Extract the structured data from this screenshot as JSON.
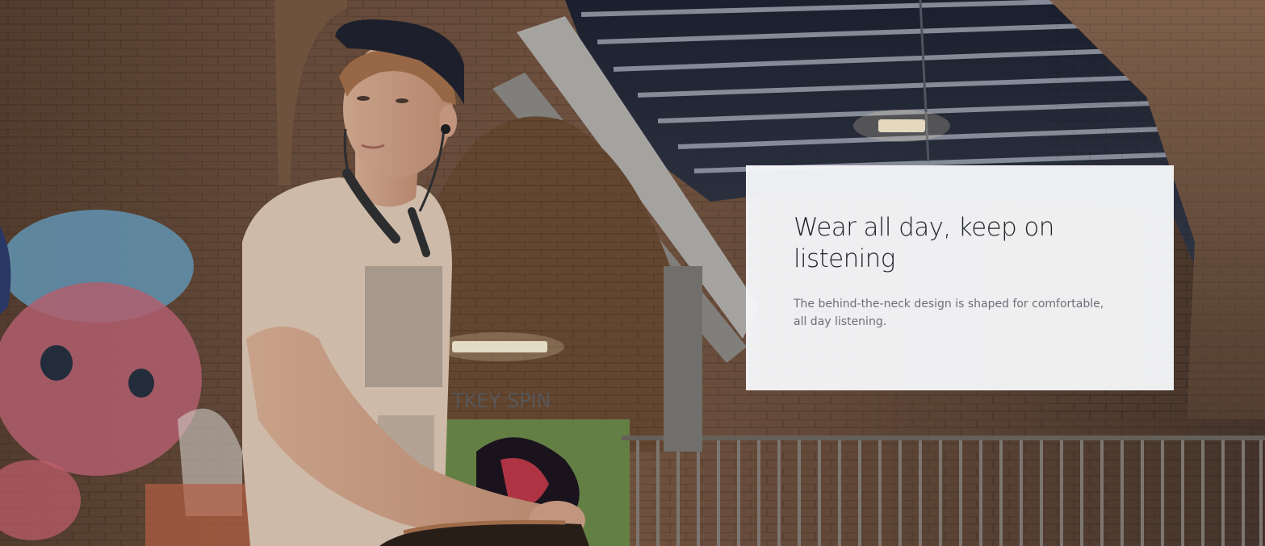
{
  "hero": {
    "image_description_icon": "person-wearing-neckband-headphones-photo",
    "card": {
      "title": "Wear all day, keep on listening",
      "text": "The behind-the-neck design is shaped for comfortable, all day listening."
    }
  },
  "colors": {
    "card_background": "#f5f6f8",
    "title": "#1f2328",
    "body_text": "#6c6f78"
  }
}
